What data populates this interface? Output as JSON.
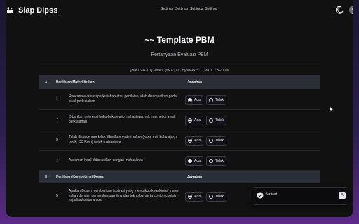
{
  "header": {
    "brand": "Siap Dipss",
    "nav": [
      "Settings",
      "Settings",
      "Settings",
      "Settings"
    ]
  },
  "page": {
    "title": "~~ Template PBM",
    "subtitle": "Pertanyaan Evaluasi PBM",
    "info": "[MIK1694201] Matkul gtw F | Dr. myadakk S.T., M.Cs. | BELUM"
  },
  "sections": [
    {
      "code": "A",
      "title": "Penilaian Materi Kuliah",
      "answer_header": "Jawaban",
      "rows": [
        {
          "num": "1",
          "question": "Rencana evaluasi perkuliahan atau penilaian telah disampaikan pada awal perkuliahan",
          "selected": "Ada"
        },
        {
          "num": "2",
          "question": "Diberikan referensi buku-buku wajib mahasiswa: ref. internet di awal perkuliahan",
          "selected": "Ada"
        },
        {
          "num": "3",
          "question": "Telah disusun dan telah diberikan materi kuliah (hand-out, buku ajar, e-book, CD Rom) untuk mahasiswa",
          "selected": "Ada"
        },
        {
          "num": "4",
          "question": "Asesmen hasil didiskusikan dengan mahasiswa",
          "selected": "Ada"
        }
      ]
    },
    {
      "code": "B",
      "title": "Penilaian Kompetensi Dosen",
      "answer_header": "Jawaban",
      "rows": [
        {
          "num": "5",
          "question": "Apakah Dosen memberikan ilustrasi yang mencakup keterkinian materi kuliah dengan perkembangan ilmu dan teknologi serta contoh-contoh kejadian/kasus aktual",
          "selected": "Ada"
        }
      ]
    }
  ],
  "options": [
    "Ada",
    "Tidak"
  ],
  "toast": {
    "text": "Saved",
    "close": "X"
  },
  "colors": {
    "background": "#111111",
    "section_bar": "#2b2e36",
    "outer_gradient_end": "#5b2a86"
  },
  "icons": [
    "logo-icon",
    "moon-icon",
    "avatar",
    "check-circle-icon",
    "close-icon",
    "cursor"
  ]
}
